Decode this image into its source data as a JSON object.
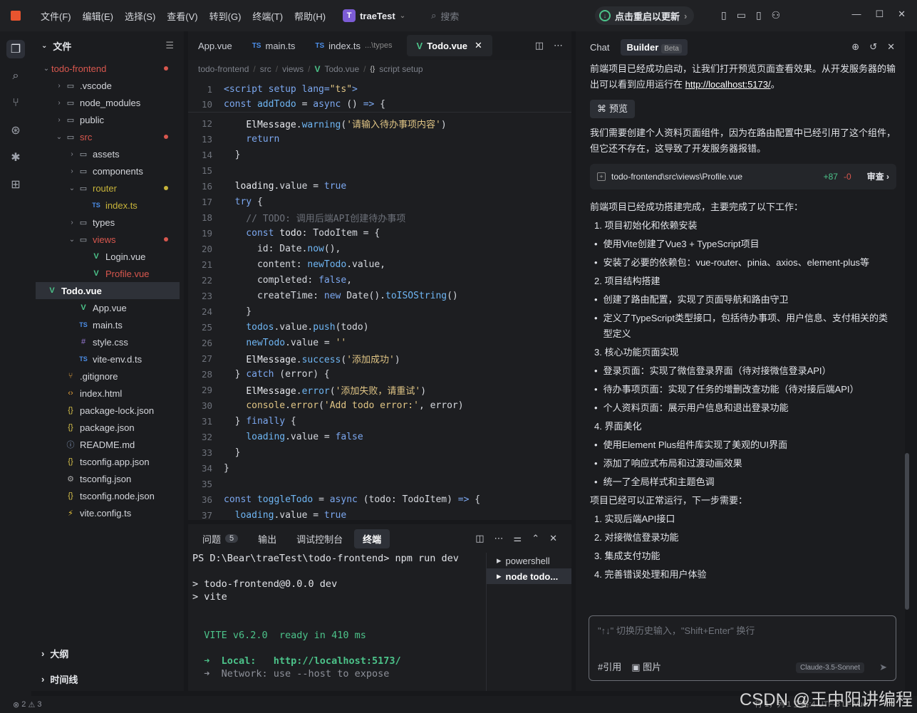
{
  "menu": [
    "文件(F)",
    "编辑(E)",
    "选择(S)",
    "查看(V)",
    "转到(G)",
    "终端(T)",
    "帮助(H)"
  ],
  "project": {
    "badge": "T",
    "name": "traeTest"
  },
  "search": {
    "placeholder": "搜索"
  },
  "restart_label": "点击重启以更新",
  "explorer": {
    "title": "文件",
    "rows": [
      {
        "name": "todo-frontend",
        "indent": 0,
        "chev": "⌄",
        "icon": "",
        "color": "#d8574e",
        "dot": "r"
      },
      {
        "name": ".vscode",
        "indent": 1,
        "chev": "›",
        "icon": "folder",
        "color": "#d4d6db"
      },
      {
        "name": "node_modules",
        "indent": 1,
        "chev": "›",
        "icon": "folder",
        "color": "#d4d6db"
      },
      {
        "name": "public",
        "indent": 1,
        "chev": "›",
        "icon": "folder",
        "color": "#d4d6db"
      },
      {
        "name": "src",
        "indent": 1,
        "chev": "⌄",
        "icon": "folder",
        "color": "#d8574e",
        "dot": "r"
      },
      {
        "name": "assets",
        "indent": 2,
        "chev": "›",
        "icon": "folder",
        "color": "#d4d6db"
      },
      {
        "name": "components",
        "indent": 2,
        "chev": "›",
        "icon": "folder",
        "color": "#d4d6db"
      },
      {
        "name": "router",
        "indent": 2,
        "chev": "⌄",
        "icon": "folder",
        "color": "#c8b43a",
        "dot": "y"
      },
      {
        "name": "index.ts",
        "indent": 3,
        "chev": "",
        "icon": "TS",
        "color": "#c8b43a"
      },
      {
        "name": "types",
        "indent": 2,
        "chev": "›",
        "icon": "folder",
        "color": "#d4d6db"
      },
      {
        "name": "views",
        "indent": 2,
        "chev": "⌄",
        "icon": "folder",
        "color": "#d8574e",
        "dot": "r"
      },
      {
        "name": "Login.vue",
        "indent": 3,
        "chev": "",
        "icon": "V",
        "color": "#d4d6db"
      },
      {
        "name": "Profile.vue",
        "indent": 3,
        "chev": "",
        "icon": "V",
        "color": "#d8574e"
      },
      {
        "name": "Todo.vue",
        "indent": 3,
        "chev": "",
        "icon": "V",
        "color": "#ffffff",
        "sel": true
      },
      {
        "name": "App.vue",
        "indent": 2,
        "chev": "",
        "icon": "V",
        "color": "#d4d6db"
      },
      {
        "name": "main.ts",
        "indent": 2,
        "chev": "",
        "icon": "TS",
        "color": "#d4d6db"
      },
      {
        "name": "style.css",
        "indent": 2,
        "chev": "",
        "icon": "#",
        "color": "#d4d6db"
      },
      {
        "name": "vite-env.d.ts",
        "indent": 2,
        "chev": "",
        "icon": "TS",
        "color": "#d4d6db"
      },
      {
        "name": ".gitignore",
        "indent": 1,
        "chev": "",
        "icon": "git",
        "color": "#d4d6db"
      },
      {
        "name": "index.html",
        "indent": 1,
        "chev": "",
        "icon": "<>",
        "color": "#d4d6db"
      },
      {
        "name": "package-lock.json",
        "indent": 1,
        "chev": "",
        "icon": "{}",
        "color": "#d4d6db"
      },
      {
        "name": "package.json",
        "indent": 1,
        "chev": "",
        "icon": "{}",
        "color": "#d4d6db"
      },
      {
        "name": "README.md",
        "indent": 1,
        "chev": "",
        "icon": "?",
        "color": "#d4d6db"
      },
      {
        "name": "tsconfig.app.json",
        "indent": 1,
        "chev": "",
        "icon": "{}",
        "color": "#d4d6db"
      },
      {
        "name": "tsconfig.json",
        "indent": 1,
        "chev": "",
        "icon": "gear",
        "color": "#d4d6db"
      },
      {
        "name": "tsconfig.node.json",
        "indent": 1,
        "chev": "",
        "icon": "{}",
        "color": "#d4d6db"
      },
      {
        "name": "vite.config.ts",
        "indent": 1,
        "chev": "",
        "icon": "bolt",
        "color": "#d4d6db"
      }
    ],
    "outline": "大纲",
    "timeline": "时间线"
  },
  "editor": {
    "tabs": [
      {
        "label": "App.vue",
        "icon": ""
      },
      {
        "label": "main.ts",
        "icon": "TS"
      },
      {
        "label": "index.ts",
        "icon": "TS",
        "hint": "...\\types"
      },
      {
        "label": "Todo.vue",
        "icon": "V",
        "active": true
      }
    ],
    "breadcrumb": [
      "todo-frontend",
      "src",
      "views",
      "Todo.vue",
      "script setup"
    ],
    "lines": [
      {
        "n": "1",
        "h": "<span class='kw'>&lt;script setup lang=</span><span class='str'>\"ts\"</span><span class='kw'>&gt;</span>"
      },
      {
        "n": "10",
        "h": "<span class='kw'>const </span><span class='fn'>addTodo</span><span class='pl'> = </span><span class='kw'>async</span><span class='pl'> () </span><span class='kw'>=&gt;</span><span class='pl'> {</span>"
      },
      {
        "n": "12",
        "h": "<span class='pl'>    </span><span class='var'>ElMessage</span><span class='pl'>.</span><span class='fn'>warning</span><span class='pl'>(</span><span class='str'>'请输入待办事项内容'</span><span class='pl'>)</span>"
      },
      {
        "n": "13",
        "h": "<span class='kw'>    return</span>"
      },
      {
        "n": "14",
        "h": "<span class='pl'>  }</span>"
      },
      {
        "n": "15",
        "h": ""
      },
      {
        "n": "16",
        "h": "<span class='pl'>  </span><span class='var'>loading</span><span class='pl'>.value = </span><span class='kw'>true</span>"
      },
      {
        "n": "17",
        "h": "<span class='kw'>  try</span><span class='pl'> {</span>"
      },
      {
        "n": "18",
        "h": "<span class='cm'>    // TODO: 调用后端API创建待办事项</span>"
      },
      {
        "n": "19",
        "h": "<span class='kw'>    const </span><span class='var'>todo</span><span class='pl'>: TodoItem = {</span>"
      },
      {
        "n": "20",
        "h": "<span class='pl'>      id: Date.</span><span class='fn'>now</span><span class='pl'>(),</span>"
      },
      {
        "n": "21",
        "h": "<span class='pl'>      content: </span><span class='fn'>newTodo</span><span class='pl'>.value,</span>"
      },
      {
        "n": "22",
        "h": "<span class='pl'>      completed: </span><span class='kw'>false</span><span class='pl'>,</span>"
      },
      {
        "n": "23",
        "h": "<span class='pl'>      createTime: </span><span class='kw'>new</span><span class='pl'> Date().</span><span class='fn'>toISOString</span><span class='pl'>()</span>"
      },
      {
        "n": "24",
        "h": "<span class='pl'>    }</span>"
      },
      {
        "n": "25",
        "h": "<span class='pl'>    </span><span class='fn'>todos</span><span class='pl'>.value.</span><span class='fn'>push</span><span class='pl'>(todo)</span>"
      },
      {
        "n": "26",
        "h": "<span class='pl'>    </span><span class='fn'>newTodo</span><span class='pl'>.value = </span><span class='str'>''</span>"
      },
      {
        "n": "27",
        "h": "<span class='pl'>    </span><span class='var'>ElMessage</span><span class='pl'>.</span><span class='fn'>success</span><span class='pl'>(</span><span class='str'>'添加成功'</span><span class='pl'>)</span>"
      },
      {
        "n": "28",
        "h": "<span class='pl'>  } </span><span class='kw'>catch</span><span class='pl'> (error) {</span>"
      },
      {
        "n": "29",
        "h": "<span class='pl'>    </span><span class='var'>ElMessage</span><span class='pl'>.</span><span class='fn'>error</span><span class='pl'>(</span><span class='str'>'添加失败，请重试'</span><span class='pl'>)</span>"
      },
      {
        "n": "30",
        "h": "<span class='pl'>    </span><span class='str'>console</span><span class='pl'>.</span><span class='str'>error</span><span class='pl'>(</span><span class='str'>'Add todo error:'</span><span class='pl'>, error)</span>"
      },
      {
        "n": "31",
        "h": "<span class='pl'>  } </span><span class='kw'>finally</span><span class='pl'> {</span>"
      },
      {
        "n": "32",
        "h": "<span class='pl'>    </span><span class='fn'>loading</span><span class='pl'>.value = </span><span class='kw'>false</span>"
      },
      {
        "n": "33",
        "h": "<span class='pl'>  }</span>"
      },
      {
        "n": "34",
        "h": "<span class='pl'>}</span>"
      },
      {
        "n": "35",
        "h": ""
      },
      {
        "n": "36",
        "h": "<span class='kw'>const </span><span class='fn'>toggleTodo</span><span class='pl'> = </span><span class='kw'>async</span><span class='pl'> (todo: TodoItem) </span><span class='kw'>=&gt;</span><span class='pl'> {</span>"
      },
      {
        "n": "37",
        "h": "<span class='pl'>  </span><span class='fn'>loading</span><span class='pl'>.value = </span><span class='kw'>true</span>"
      }
    ]
  },
  "terminal": {
    "tabs": [
      {
        "label": "问题",
        "count": "5"
      },
      {
        "label": "输出"
      },
      {
        "label": "调试控制台"
      },
      {
        "label": "终端",
        "active": true
      }
    ],
    "lines": [
      "PS D:\\Bear\\traeTest\\todo-frontend> npm run dev",
      "",
      "> todo-frontend@0.0.0 dev",
      "> vite",
      "",
      "",
      "  VITE v6.2.0  ready in 410 ms",
      "",
      "  ➜  Local:   http://localhost:5173/",
      "  ➜  Network: use --host to expose"
    ],
    "sessions": [
      {
        "label": "powershell"
      },
      {
        "label": "node todo...",
        "sel": true
      }
    ]
  },
  "chat": {
    "tabs": [
      "Chat",
      "Builder"
    ],
    "beta": "Beta",
    "p1": "前端项目已经成功启动，让我们打开预览页面查看效果。从开发服务器的输出可以看到应用运行在 ",
    "p1_link": "http://localhost:5173/",
    "p1_end": "。",
    "preview": "预览",
    "p2": "我们需要创建个人资料页面组件，因为在路由配置中已经引用了这个组件，但它还不存在，这导致了开发服务器报错。",
    "file_path": "todo-frontend\\src\\views\\Profile.vue",
    "file_add": "+87",
    "file_del": "-0",
    "review": "审查",
    "p3": "前端项目已经成功搭建完成，主要完成了以下工作：",
    "items": [
      {
        "t": "num",
        "v": "1. 项目初始化和依赖安装"
      },
      {
        "t": "bul",
        "v": "使用Vite创建了Vue3 + TypeScript项目"
      },
      {
        "t": "bul",
        "v": "安装了必要的依赖包：vue-router、pinia、axios、element-plus等"
      },
      {
        "t": "num",
        "v": "2. 项目结构搭建"
      },
      {
        "t": "bul",
        "v": "创建了路由配置，实现了页面导航和路由守卫"
      },
      {
        "t": "bul",
        "v": "定义了TypeScript类型接口，包括待办事项、用户信息、支付相关的类型定义"
      },
      {
        "t": "num",
        "v": "3. 核心功能页面实现"
      },
      {
        "t": "bul",
        "v": "登录页面：实现了微信登录界面（待对接微信登录API）"
      },
      {
        "t": "bul",
        "v": "待办事项页面：实现了任务的增删改查功能（待对接后端API）"
      },
      {
        "t": "bul",
        "v": "个人资料页面：展示用户信息和退出登录功能"
      },
      {
        "t": "num",
        "v": "4. 界面美化"
      },
      {
        "t": "bul",
        "v": "使用Element Plus组件库实现了美观的UI界面"
      },
      {
        "t": "bul",
        "v": "添加了响应式布局和过渡动画效果"
      },
      {
        "t": "bul",
        "v": "统一了全局样式和主题色调"
      }
    ],
    "p4": "项目已经可以正常运行，下一步需要：",
    "next": [
      "1. 实现后端API接口",
      "2. 对接微信登录功能",
      "3. 集成支付功能",
      "4. 完善错误处理和用户体验"
    ],
    "input_placeholder": "\"↑↓\" 切换历史输入，\"Shift+Enter\" 换行",
    "tool_ref": "#引用",
    "tool_img": "图片",
    "model": "Claude-3.5-Sonnet"
  },
  "status": {
    "errors": "2",
    "warnings": "3",
    "right": "行 1，列 1  空格:4  UTF-8  LF  Vue"
  },
  "watermark": "CSDN @王中阳讲编程"
}
